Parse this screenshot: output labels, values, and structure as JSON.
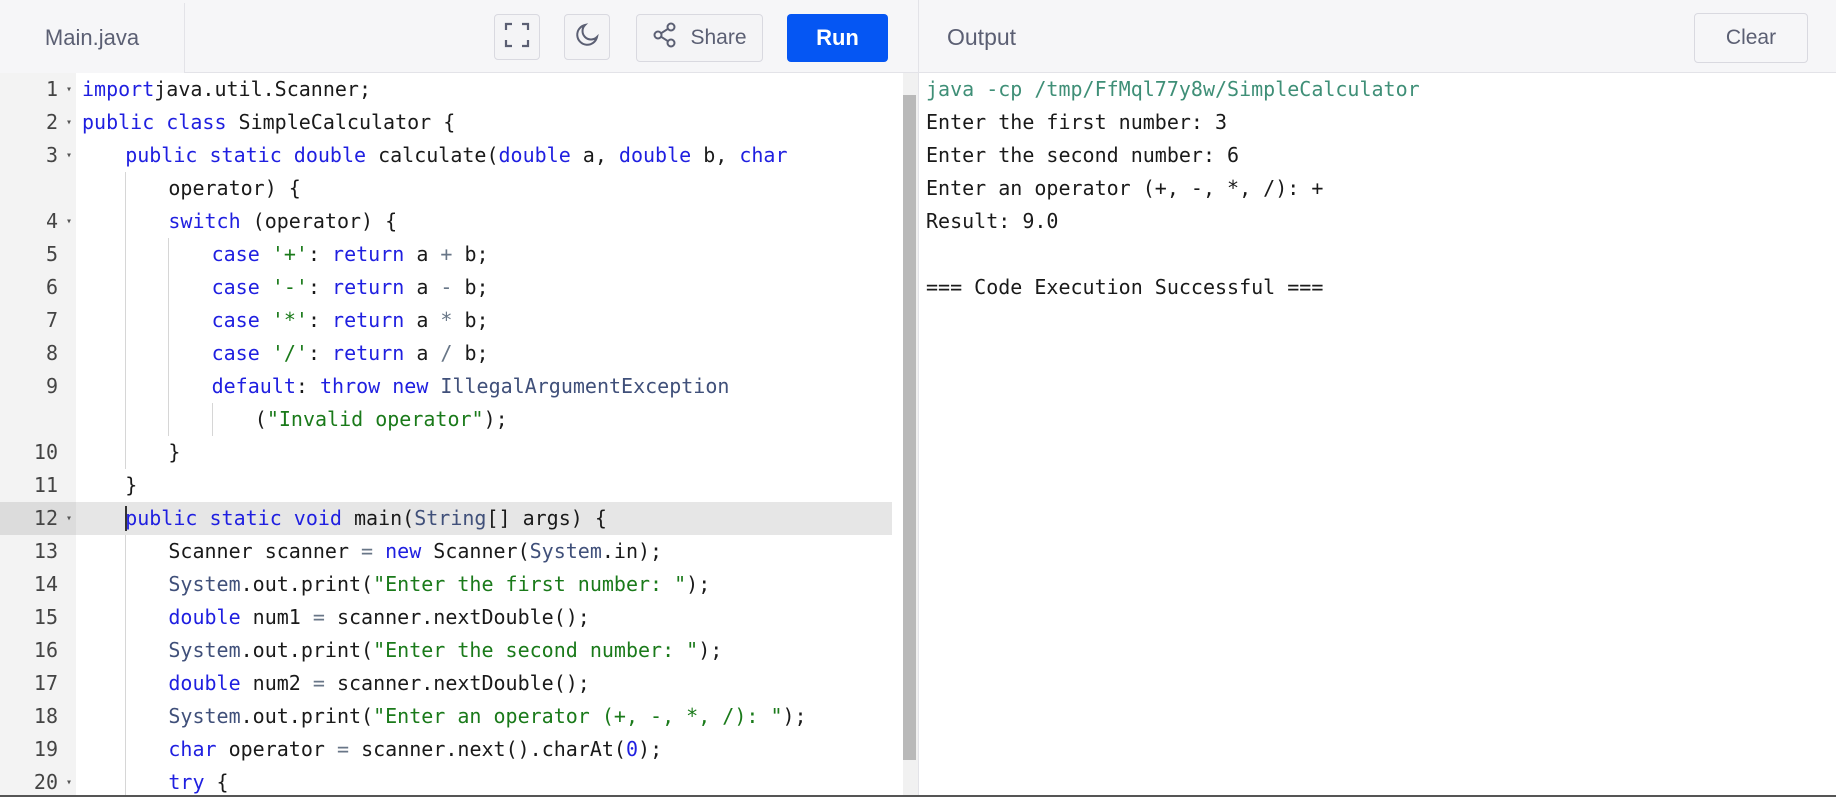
{
  "editor": {
    "file_tab": "Main.java",
    "toolbar": {
      "fullscreen_icon": "fullscreen-icon",
      "theme_icon": "moon-icon",
      "share_label": "Share",
      "run_label": "Run"
    },
    "code_lines": [
      {
        "n": "1",
        "fold": true,
        "segs": [
          [
            "kw",
            "import"
          ],
          [
            "",
            "java.util.Scanner;"
          ]
        ]
      },
      {
        "n": "2",
        "fold": true,
        "segs": [
          [
            "kw",
            "public"
          ],
          [
            "",
            " "
          ],
          [
            "kw",
            "class"
          ],
          [
            "",
            " SimpleCalculator {"
          ]
        ]
      },
      {
        "n": "3",
        "fold": true,
        "indent": 1,
        "segs": [
          [
            "kw",
            "public"
          ],
          [
            "",
            " "
          ],
          [
            "kw",
            "static"
          ],
          [
            "",
            " "
          ],
          [
            "kw",
            "double"
          ],
          [
            "",
            " calculate("
          ],
          [
            "kw",
            "double"
          ],
          [
            "",
            " a, "
          ],
          [
            "kw",
            "double"
          ],
          [
            "",
            " b, "
          ],
          [
            "kw",
            "char"
          ]
        ]
      },
      {
        "n": "",
        "indent": 2,
        "segs": [
          [
            "",
            "operator) {"
          ]
        ]
      },
      {
        "n": "4",
        "fold": true,
        "indent": 2,
        "segs": [
          [
            "kw",
            "switch"
          ],
          [
            "",
            " (operator) {"
          ]
        ]
      },
      {
        "n": "5",
        "indent": 3,
        "segs": [
          [
            "kw",
            "case"
          ],
          [
            "",
            " "
          ],
          [
            "st",
            "'+'"
          ],
          [
            "",
            ": "
          ],
          [
            "kw",
            "return"
          ],
          [
            "",
            " a "
          ],
          [
            "op",
            "+"
          ],
          [
            "",
            " b;"
          ]
        ]
      },
      {
        "n": "6",
        "indent": 3,
        "segs": [
          [
            "kw",
            "case"
          ],
          [
            "",
            " "
          ],
          [
            "st",
            "'-'"
          ],
          [
            "",
            ": "
          ],
          [
            "kw",
            "return"
          ],
          [
            "",
            " a "
          ],
          [
            "op",
            "-"
          ],
          [
            "",
            " b;"
          ]
        ]
      },
      {
        "n": "7",
        "indent": 3,
        "segs": [
          [
            "kw",
            "case"
          ],
          [
            "",
            " "
          ],
          [
            "st",
            "'*'"
          ],
          [
            "",
            ": "
          ],
          [
            "kw",
            "return"
          ],
          [
            "",
            " a "
          ],
          [
            "op",
            "*"
          ],
          [
            "",
            " b;"
          ]
        ]
      },
      {
        "n": "8",
        "indent": 3,
        "segs": [
          [
            "kw",
            "case"
          ],
          [
            "",
            " "
          ],
          [
            "st",
            "'/'"
          ],
          [
            "",
            ": "
          ],
          [
            "kw",
            "return"
          ],
          [
            "",
            " a "
          ],
          [
            "op",
            "/"
          ],
          [
            "",
            " b;"
          ]
        ]
      },
      {
        "n": "9",
        "indent": 3,
        "segs": [
          [
            "kw",
            "default"
          ],
          [
            "",
            ": "
          ],
          [
            "kw",
            "throw"
          ],
          [
            "",
            " "
          ],
          [
            "kw",
            "new"
          ],
          [
            "",
            " "
          ],
          [
            "ty",
            "IllegalArgumentException"
          ]
        ]
      },
      {
        "n": "",
        "indent": 4,
        "segs": [
          [
            "",
            "("
          ],
          [
            "st",
            "\"Invalid operator\""
          ],
          [
            "",
            ");"
          ]
        ]
      },
      {
        "n": "10",
        "indent": 2,
        "segs": [
          [
            "",
            "}"
          ]
        ]
      },
      {
        "n": "11",
        "indent": 1,
        "segs": [
          [
            "",
            "}"
          ]
        ]
      },
      {
        "n": "12",
        "fold": true,
        "active": true,
        "indent": 1,
        "segs": [
          [
            "kw",
            "public"
          ],
          [
            "",
            " "
          ],
          [
            "kw",
            "static"
          ],
          [
            "",
            " "
          ],
          [
            "kw",
            "void"
          ],
          [
            "",
            " main("
          ],
          [
            "ty",
            "String"
          ],
          [
            "",
            "[] args) {"
          ]
        ]
      },
      {
        "n": "13",
        "indent": 2,
        "segs": [
          [
            "",
            "Scanner scanner "
          ],
          [
            "op",
            "="
          ],
          [
            "",
            " "
          ],
          [
            "kw",
            "new"
          ],
          [
            "",
            " Scanner("
          ],
          [
            "ty",
            "System"
          ],
          [
            "",
            ".in);"
          ]
        ]
      },
      {
        "n": "14",
        "indent": 2,
        "segs": [
          [
            "ty",
            "System"
          ],
          [
            "",
            ".out.print("
          ],
          [
            "st",
            "\"Enter the first number: \""
          ],
          [
            "",
            ");"
          ]
        ]
      },
      {
        "n": "15",
        "indent": 2,
        "segs": [
          [
            "kw",
            "double"
          ],
          [
            "",
            " num1 "
          ],
          [
            "op",
            "="
          ],
          [
            "",
            " scanner.nextDouble();"
          ]
        ]
      },
      {
        "n": "16",
        "indent": 2,
        "segs": [
          [
            "ty",
            "System"
          ],
          [
            "",
            ".out.print("
          ],
          [
            "st",
            "\"Enter the second number: \""
          ],
          [
            "",
            ");"
          ]
        ]
      },
      {
        "n": "17",
        "indent": 2,
        "segs": [
          [
            "kw",
            "double"
          ],
          [
            "",
            " num2 "
          ],
          [
            "op",
            "="
          ],
          [
            "",
            " scanner.nextDouble();"
          ]
        ]
      },
      {
        "n": "18",
        "indent": 2,
        "segs": [
          [
            "ty",
            "System"
          ],
          [
            "",
            ".out.print("
          ],
          [
            "st",
            "\"Enter an operator (+, -, *, /): \""
          ],
          [
            "",
            ");"
          ]
        ]
      },
      {
        "n": "19",
        "indent": 2,
        "segs": [
          [
            "kw",
            "char"
          ],
          [
            "",
            " operator "
          ],
          [
            "op",
            "="
          ],
          [
            "",
            " scanner.next().charAt("
          ],
          [
            "nu",
            "0"
          ],
          [
            "",
            ");"
          ]
        ]
      },
      {
        "n": "20",
        "fold": true,
        "indent": 2,
        "segs": [
          [
            "kw",
            "try"
          ],
          [
            "",
            " {"
          ]
        ]
      }
    ]
  },
  "output": {
    "title": "Output",
    "clear_label": "Clear",
    "lines": [
      {
        "cls": "cmd",
        "text": "java -cp /tmp/FfMql77y8w/SimpleCalculator"
      },
      {
        "cls": "",
        "text": "Enter the first number: 3"
      },
      {
        "cls": "",
        "text": "Enter the second number: 6"
      },
      {
        "cls": "",
        "text": "Enter an operator (+, -, *, /): +"
      },
      {
        "cls": "",
        "text": "Result: 9.0"
      },
      {
        "cls": "",
        "text": ""
      },
      {
        "cls": "",
        "text": "=== Code Execution Successful ==="
      }
    ]
  }
}
